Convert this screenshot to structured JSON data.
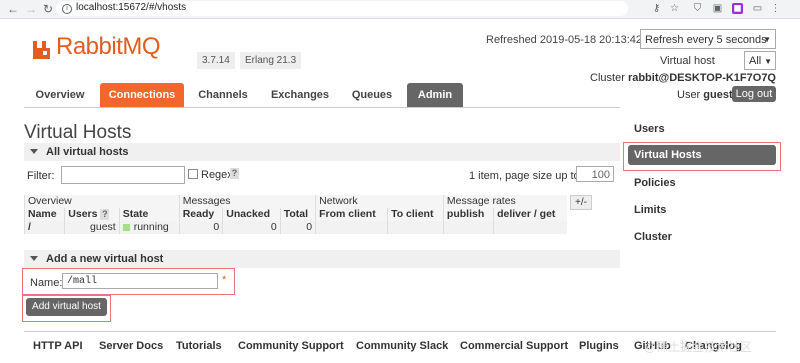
{
  "browser": {
    "url": "localhost:15672/#/vhosts"
  },
  "header": {
    "logo_text": "RabbitMQ",
    "version": "3.7.14",
    "erlang": "Erlang 21.3",
    "refreshed": "Refreshed 2019-05-18 20:13:42",
    "refresh_option": "Refresh every 5 seconds",
    "vhost_label": "Virtual host",
    "vhost_value": "All",
    "cluster_label": "Cluster",
    "cluster_value": "rabbit@DESKTOP-K1F7O7Q",
    "user_label": "User",
    "user_value": "guest",
    "logout": "Log out"
  },
  "tabs": [
    "Overview",
    "Connections",
    "Channels",
    "Exchanges",
    "Queues",
    "Admin"
  ],
  "main": {
    "title": "Virtual Hosts",
    "all_section": "All virtual hosts",
    "filter_label": "Filter:",
    "regex_label": "Regex",
    "help": "?",
    "page_size_label": "1 item, page size up to",
    "page_size_value": "100",
    "plus_minus": "+/-",
    "table": {
      "groups": [
        "Overview",
        "Messages",
        "Network",
        "Message rates"
      ],
      "columns": [
        "Name",
        "Users",
        "State",
        "Ready",
        "Unacked",
        "Total",
        "From client",
        "To client",
        "publish",
        "deliver / get"
      ],
      "rows": [
        {
          "name": "/",
          "users": "guest",
          "state": "running",
          "ready": "0",
          "unacked": "0",
          "total": "0",
          "from_client": "",
          "to_client": "",
          "publish": "",
          "deliver_get": ""
        }
      ]
    },
    "add_section": "Add a new virtual host",
    "name_label": "Name:",
    "name_value": "/mall",
    "required": "*",
    "add_button": "Add virtual host"
  },
  "sidebar": [
    "Users",
    "Virtual Hosts",
    "Policies",
    "Limits",
    "Cluster"
  ],
  "footer": [
    "HTTP API",
    "Server Docs",
    "Tutorials",
    "Community Support",
    "Community Slack",
    "Commercial Support",
    "Plugins",
    "GitHub",
    "Changelog"
  ],
  "watermark": "@稀土掘金技术社区",
  "colors": {
    "brand_orange": "#f3672c",
    "admin_gray": "#666666",
    "running_green": "#a1e27a",
    "highlight_red": "#e8777d"
  }
}
